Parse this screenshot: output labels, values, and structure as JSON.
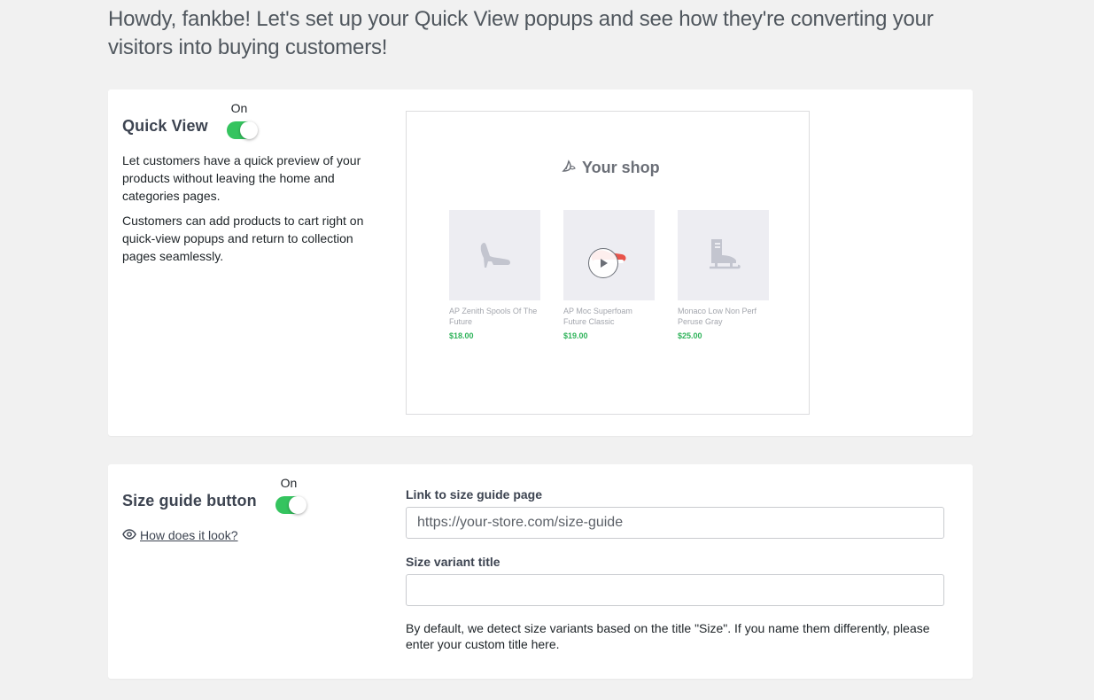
{
  "header": {
    "headline": "Howdy, fankbe! Let's set up your Quick View popups and see how they're converting your visitors into buying customers!"
  },
  "quick_view": {
    "title": "Quick View",
    "toggle_state": "On",
    "enabled": true,
    "description_1": "Let customers have a quick preview of your products without leaving the home and categories pages.",
    "description_2": "Customers can add products to cart right on quick-view popups and return to collection pages seamlessly.",
    "preview": {
      "shop_title": "Your shop",
      "shop_icon": "leaf-icon",
      "products": [
        {
          "name": "AP Zenith Spools Of The Future",
          "price": "$18.00",
          "icon": "high-heel-shoe-icon"
        },
        {
          "name": "AP Moc Superfoam Future Classic",
          "price": "$19.00",
          "icon": "play-icon"
        },
        {
          "name": "Monaco Low Non Perf Peruse Gray",
          "price": "$25.00",
          "icon": "ice-skate-icon"
        }
      ]
    }
  },
  "size_guide": {
    "title": "Size guide button",
    "toggle_state": "On",
    "enabled": true,
    "how_link": "How does it look?",
    "link_label": "Link to size guide page",
    "link_placeholder": "https://your-store.com/size-guide",
    "variant_label": "Size variant title",
    "variant_value": "",
    "help_text": "By default, we detect size variants based on the title \"Size\". If you name them differently, please enter your custom title here."
  },
  "colors": {
    "toggle_on": "#35c45f",
    "price_green": "#2fb35a",
    "page_bg": "#f1f1f1"
  }
}
